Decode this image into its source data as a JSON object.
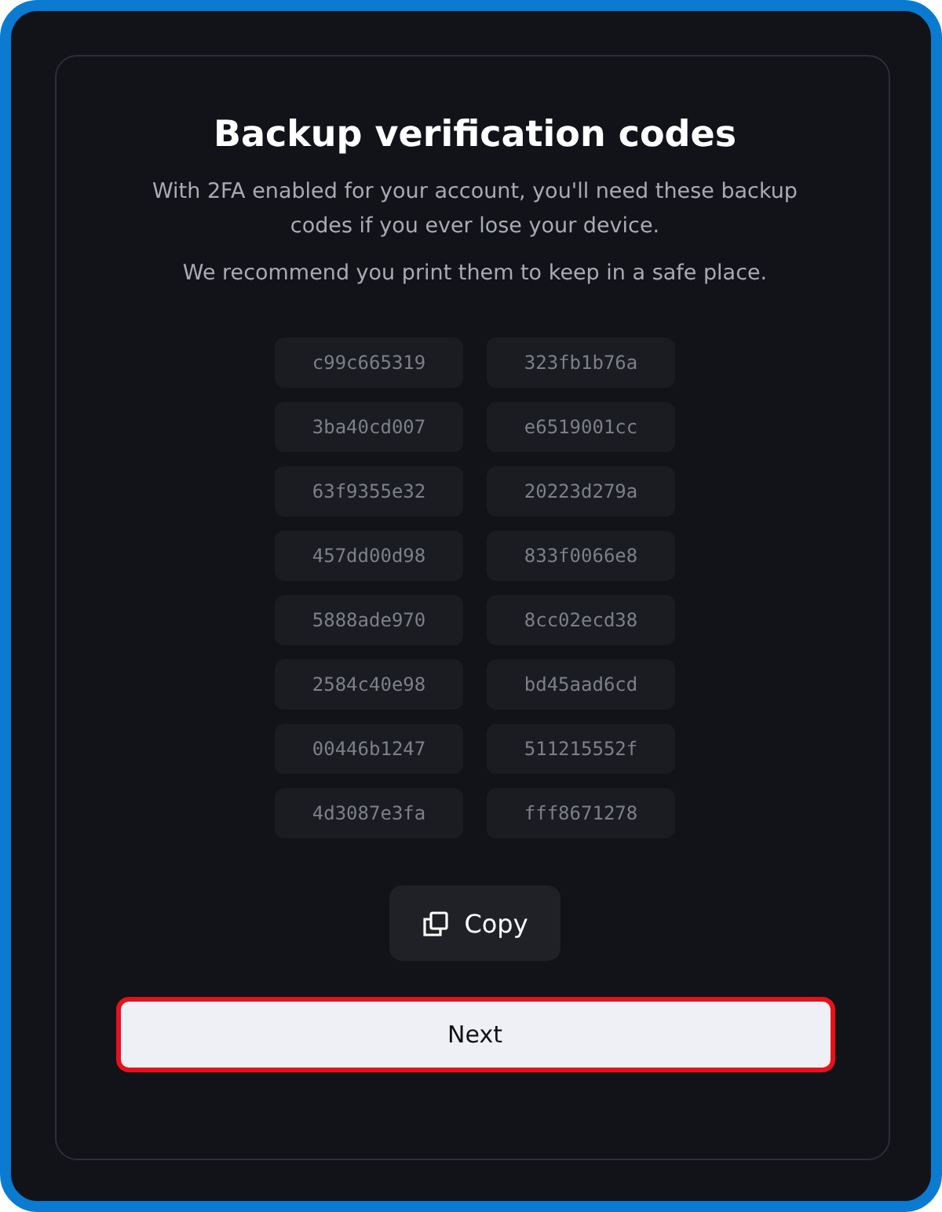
{
  "dialog": {
    "title": "Backup verification codes",
    "description": "With 2FA enabled for your account, you'll need these backup codes if you ever lose your device.",
    "recommendation": "We recommend you print them to keep in a safe place.",
    "codes": [
      "c99c665319",
      "323fb1b76a",
      "3ba40cd007",
      "e6519001cc",
      "63f9355e32",
      "20223d279a",
      "457dd00d98",
      "833f0066e8",
      "5888ade970",
      "8cc02ecd38",
      "2584c40e98",
      "bd45aad6cd",
      "00446b1247",
      "511215552f",
      "4d3087e3fa",
      "fff8671278"
    ],
    "copy_button": {
      "label": "Copy"
    },
    "next_button": {
      "label": "Next",
      "focused": true
    }
  }
}
